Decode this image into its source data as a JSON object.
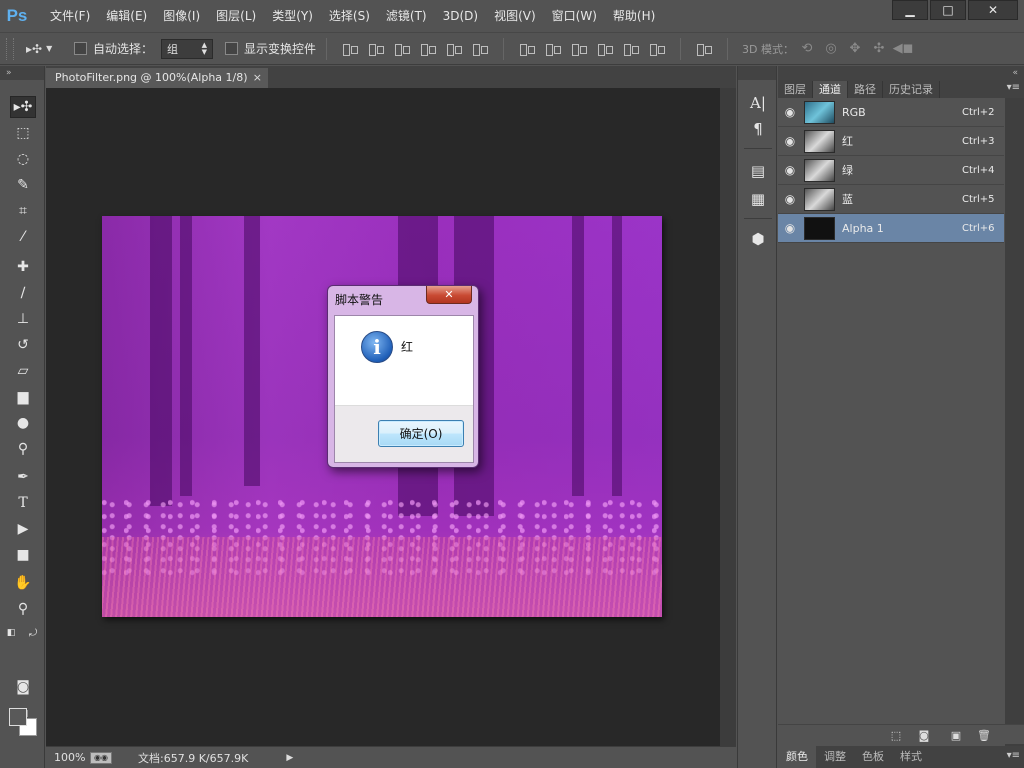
{
  "app": {
    "logo": "Ps"
  },
  "menu": [
    {
      "label": "文件(F)",
      "name": "menu-file"
    },
    {
      "label": "编辑(E)",
      "name": "menu-edit"
    },
    {
      "label": "图像(I)",
      "name": "menu-image"
    },
    {
      "label": "图层(L)",
      "name": "menu-layer"
    },
    {
      "label": "类型(Y)",
      "name": "menu-type"
    },
    {
      "label": "选择(S)",
      "name": "menu-select"
    },
    {
      "label": "滤镜(T)",
      "name": "menu-filter"
    },
    {
      "label": "3D(D)",
      "name": "menu-3d"
    },
    {
      "label": "视图(V)",
      "name": "menu-view"
    },
    {
      "label": "窗口(W)",
      "name": "menu-window"
    },
    {
      "label": "帮助(H)",
      "name": "menu-help"
    }
  ],
  "window_controls": {
    "minimize": "▁",
    "maximize": "□",
    "close": "✕"
  },
  "options": {
    "auto_select_label": "自动选择：",
    "auto_select_value": "组",
    "show_transform_label": "显示变换控件",
    "mode_3d_label": "3D 模式："
  },
  "document": {
    "tab_title": "PhotoFilter.png @ 100%(Alpha 1/8)",
    "tab_close": "×",
    "zoom": "100%",
    "doc_info": "文档:657.9 K/657.9K"
  },
  "dialog": {
    "title": "脚本警告",
    "close": "✕",
    "icon": "info-icon",
    "message": "红",
    "ok_label": "确定(O)"
  },
  "channels_panel": {
    "tabs": [
      "图层",
      "通道",
      "路径",
      "历史记录"
    ],
    "active_tab": "通道",
    "channels": [
      {
        "name": "RGB",
        "shortcut": "Ctrl+2",
        "thumb": "rgb",
        "selected": false
      },
      {
        "name": "红",
        "shortcut": "Ctrl+3",
        "thumb": "gray",
        "selected": false
      },
      {
        "name": "绿",
        "shortcut": "Ctrl+4",
        "thumb": "gray",
        "selected": false
      },
      {
        "name": "蓝",
        "shortcut": "Ctrl+5",
        "thumb": "gray",
        "selected": false
      },
      {
        "name": "Alpha 1",
        "shortcut": "Ctrl+6",
        "thumb": "black",
        "selected": true
      }
    ]
  },
  "bottom_panel": {
    "tabs": [
      "颜色",
      "调整",
      "色板",
      "样式"
    ],
    "active_tab": "颜色"
  },
  "colors": {
    "foreground": "#595959",
    "background": "#ffffff",
    "selection": "#6a85a6",
    "ps_blue": "#5fb1f0"
  }
}
